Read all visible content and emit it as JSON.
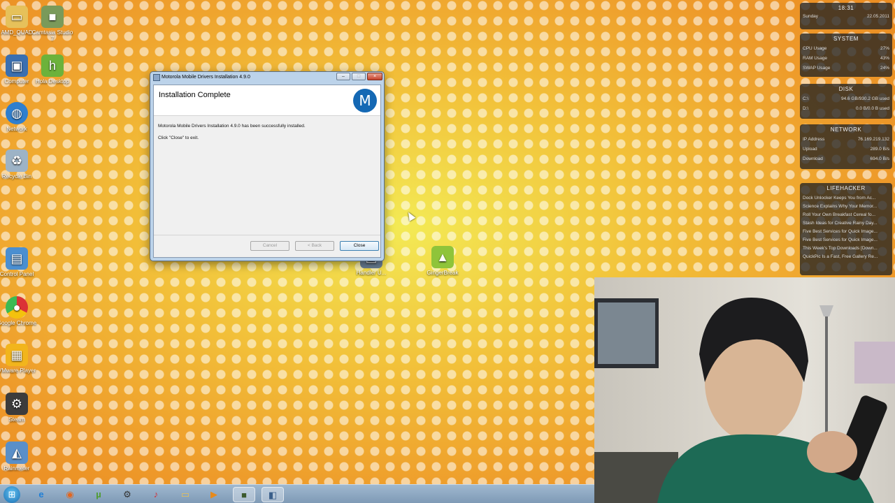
{
  "desktop_icons": [
    {
      "label": "AMD_QUAD",
      "icon": "folder-icon"
    },
    {
      "label": "Camtasia Studio 7",
      "icon": "camtasia-icon"
    },
    {
      "label": "Computer",
      "icon": "computer-icon"
    },
    {
      "label": "Hola Desktop",
      "icon": "hola-icon"
    },
    {
      "label": "Network",
      "icon": "network-icon"
    },
    {
      "label": "Recycle Bin",
      "icon": "recycle-bin-icon"
    },
    {
      "label": "Control Panel",
      "icon": "control-panel-icon"
    },
    {
      "label": "Google Chrome",
      "icon": "chrome-icon"
    },
    {
      "label": "VMware Player",
      "icon": "vmware-icon"
    },
    {
      "label": "Steam",
      "icon": "steam-icon"
    },
    {
      "label": "Rainmeter",
      "icon": "rainmeter-icon"
    },
    {
      "label": "Handler U...",
      "icon": "handler-icon"
    },
    {
      "label": "GingerBreak",
      "icon": "android-icon"
    }
  ],
  "dialog": {
    "title": "Motorola Mobile Drivers Installation 4.9.0",
    "heading": "Installation Complete",
    "message": "Motorola Mobile Drivers Installation 4.9.0 has been successfully installed.",
    "hint": "Click \"Close\" to exit.",
    "buttons": {
      "cancel": "Cancel",
      "back": "< Back",
      "close": "Close"
    },
    "titlebar_buttons": {
      "minimize": "–",
      "maximize": "□",
      "close": "×"
    },
    "logo_glyph": "M"
  },
  "gadgets": {
    "clock": {
      "time": "18:31",
      "day": "Sunday",
      "date": "22.05.2011"
    },
    "system": {
      "title": "SYSTEM",
      "rows": [
        {
          "label": "CPU Usage",
          "value": "27%"
        },
        {
          "label": "RAM Usage",
          "value": "43%"
        },
        {
          "label": "SWAP Usage",
          "value": "24%"
        }
      ]
    },
    "disk": {
      "title": "DISK",
      "rows": [
        {
          "label": "C:\\",
          "value": "94.6 GB/930.2 GB used"
        },
        {
          "label": "D:\\",
          "value": "0.0 B/0.0 B used"
        }
      ]
    },
    "network": {
      "title": "NETWORK",
      "rows": [
        {
          "label": "IP Address",
          "value": "76.169.219.132"
        },
        {
          "label": "Upload",
          "value": "289.0 B/s"
        },
        {
          "label": "Download",
          "value": "694.0 B/s"
        }
      ]
    },
    "lifehacker": {
      "title": "LIFEHACKER",
      "items": [
        "Dock Unlocker Keeps You from Ac...",
        "Science Explains Why Your Memor...",
        "Roll Your Own Breakfast Cereal fo...",
        "Stash Ideas for Creative Rainy Day...",
        "Five Best Services for Quick Image...",
        "Five Best Services for Quick Image...",
        "This Week's Top Downloads [Down...",
        "QuickPic Is a Fast, Free Gallery Re..."
      ]
    }
  },
  "taskbar": {
    "start_glyph": "⊞",
    "items": [
      {
        "name": "ie-icon",
        "glyph": "e"
      },
      {
        "name": "firefox-icon",
        "glyph": "◉"
      },
      {
        "name": "utorrent-icon",
        "glyph": "µ"
      },
      {
        "name": "steam-taskbar-icon",
        "glyph": "⚙"
      },
      {
        "name": "winamp-icon",
        "glyph": "♪"
      },
      {
        "name": "explorer-folder-icon",
        "glyph": "▭"
      },
      {
        "name": "media-player-icon",
        "glyph": "▶"
      },
      {
        "name": "camtasia-taskbar-icon",
        "glyph": "■"
      },
      {
        "name": "installer-taskbar-icon",
        "glyph": "◧"
      }
    ]
  }
}
